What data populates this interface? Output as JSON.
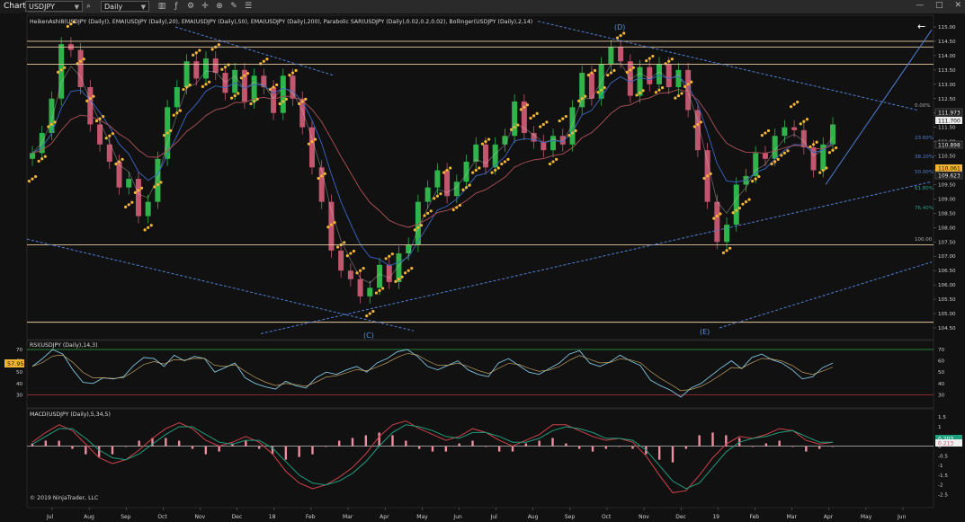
{
  "toolbar": {
    "tab_label": "Chart",
    "instrument": "USDJPY",
    "timeframe": "Daily",
    "window_buttons": [
      "—",
      "□",
      "✕"
    ]
  },
  "panels": {
    "price": {
      "indicator_header": "HeikenAshi8(USDJPY (Daily)), EMA(USDJPY (Daily),20), EMA(USDJPY (Daily),50), EMA(USDJPY (Daily),200), Parabolic SAR(USDJPY (Daily),0.02,0.2,0.02), Bollinger(USDJPY (Daily),2,14)",
      "wave_labels": [
        "(D)",
        "(C)",
        "(E)"
      ],
      "fib_labels": [
        "0.00%",
        "23.60%",
        "38.20%",
        "50.00%",
        "61.80%",
        "76.40%",
        "100.00"
      ],
      "price_badges": [
        "111.973",
        "111.700",
        "110.898",
        "110.061",
        "109.623"
      ],
      "arrow_glyph": "←"
    },
    "rsi": {
      "header": "RSI(USDJPY (Daily),14,3)",
      "current_value": "57.95"
    },
    "macd": {
      "header": "MACD(USDJPY (Daily),5,34,5)",
      "badge_1": "0.203",
      "badge_2": "0.213"
    }
  },
  "copyright": "© 2019 NinjaTrader, LLC",
  "colors": {
    "background": "#111111",
    "bull_candle": "#2fb34a",
    "bear_candle": "#c2566e",
    "sar_dots": "#f2b533",
    "trendline": "#4f7fd1",
    "horizontal_line": "#e8c9a0",
    "ema_200": "#b1525a",
    "ema_50": "#3b67c4",
    "rsi_line": "#7ec2dd",
    "macd_line": "#d0424a",
    "macd_signal": "#1f9d7d",
    "macd_histogram": "#f08ea1"
  },
  "chart_data": {
    "type": "candlestick",
    "instrument": "USDJPY",
    "timeframe": "Daily",
    "x_axis_ticks": [
      "Jul",
      "Aug",
      "Sep",
      "Oct",
      "Nov",
      "Dec",
      "18",
      "Feb",
      "Mar",
      "Apr",
      "May",
      "Jun",
      "Jul",
      "Aug",
      "Sep",
      "Oct",
      "Nov",
      "Dec",
      "19",
      "Feb",
      "Mar",
      "Apr",
      "May",
      "Jun"
    ],
    "price_axis": {
      "ticks": [
        104.5,
        105.0,
        105.5,
        106.0,
        106.5,
        107.0,
        107.5,
        108.0,
        108.5,
        109.0,
        109.5,
        110.0,
        110.5,
        111.0,
        111.5,
        112.0,
        112.5,
        113.0,
        113.5,
        114.0,
        114.5,
        115.0
      ],
      "range": [
        104.3,
        115.2
      ]
    },
    "price_series": {
      "name": "USDJPY",
      "closes": [
        110.6,
        111.3,
        112.5,
        114.4,
        114.2,
        112.9,
        111.6,
        110.9,
        110.3,
        109.4,
        109.7,
        108.4,
        108.9,
        110.4,
        112.2,
        112.9,
        113.8,
        113.2,
        113.9,
        113.4,
        112.7,
        113.5,
        112.4,
        113.3,
        112.9,
        112.0,
        113.3,
        112.5,
        111.5,
        110.1,
        108.9,
        107.2,
        106.5,
        106.2,
        105.6,
        105.9,
        106.7,
        106.1,
        107.1,
        107.4,
        108.9,
        109.4,
        110.0,
        109.1,
        109.6,
        110.3,
        110.9,
        110.1,
        110.9,
        111.2,
        112.4,
        111.3,
        111.0,
        110.7,
        111.2,
        110.9,
        112.2,
        113.4,
        112.5,
        113.7,
        114.3,
        113.8,
        112.6,
        113.6,
        113.0,
        113.7,
        112.9,
        113.5,
        112.1,
        110.7,
        108.9,
        107.5,
        108.1,
        109.5,
        109.8,
        110.6,
        110.4,
        111.2,
        111.5,
        111.4,
        110.8,
        110.0,
        110.9,
        111.6
      ]
    },
    "horizontal_levels": [
      114.5,
      114.3,
      113.7,
      107.4,
      104.7
    ],
    "rsi_axis": {
      "ticks": [
        30,
        40,
        50,
        60,
        70
      ],
      "range": [
        20,
        74
      ],
      "overbought": 70,
      "oversold": 30
    },
    "rsi_series": {
      "values": [
        55,
        62,
        70,
        66,
        52,
        41,
        40,
        45,
        44,
        46,
        56,
        63,
        62,
        55,
        65,
        60,
        64,
        62,
        50,
        54,
        58,
        45,
        40,
        37,
        35,
        42,
        38,
        36,
        45,
        50,
        48,
        52,
        55,
        50,
        58,
        62,
        68,
        70,
        64,
        55,
        52,
        56,
        60,
        52,
        48,
        46,
        58,
        62,
        56,
        50,
        48,
        53,
        58,
        66,
        69,
        58,
        55,
        59,
        65,
        60,
        56,
        43,
        38,
        34,
        28,
        36,
        40,
        47,
        54,
        60,
        53,
        63,
        66,
        61,
        58,
        52,
        44,
        46,
        54,
        58
      ]
    },
    "macd_axis": {
      "ticks": [
        -2.5,
        -2,
        -1.5,
        -1,
        -0.5,
        0,
        0.5,
        1,
        1.5
      ],
      "range": [
        -2.8,
        1.6
      ]
    },
    "macd_series": {
      "macd": [
        0.2,
        0.7,
        1.1,
        0.8,
        0.1,
        -0.6,
        -0.9,
        -0.7,
        -0.2,
        0.4,
        0.9,
        1.2,
        0.9,
        0.3,
        0.0,
        0.2,
        0.5,
        0.2,
        -0.4,
        -1.3,
        -1.9,
        -2.2,
        -2.0,
        -1.6,
        -1.1,
        -0.4,
        0.5,
        1.1,
        1.3,
        0.9,
        0.6,
        0.3,
        0.5,
        0.9,
        0.7,
        0.3,
        0.0,
        0.3,
        0.6,
        1.1,
        1.1,
        0.8,
        0.5,
        0.3,
        0.4,
        0.2,
        -0.5,
        -1.5,
        -2.4,
        -2.3,
        -1.5,
        -0.6,
        0.1,
        0.5,
        0.4,
        0.6,
        0.9,
        0.8,
        0.3,
        0.1,
        0.2
      ],
      "signal": [
        0.1,
        0.5,
        0.9,
        0.9,
        0.4,
        -0.2,
        -0.6,
        -0.7,
        -0.4,
        0.1,
        0.6,
        1.0,
        1.0,
        0.6,
        0.2,
        0.1,
        0.3,
        0.3,
        -0.1,
        -0.8,
        -1.5,
        -1.9,
        -2.0,
        -1.8,
        -1.4,
        -0.8,
        0.0,
        0.7,
        1.1,
        1.0,
        0.8,
        0.5,
        0.4,
        0.7,
        0.7,
        0.5,
        0.2,
        0.2,
        0.4,
        0.8,
        1.0,
        0.9,
        0.7,
        0.4,
        0.4,
        0.3,
        -0.2,
        -1.0,
        -1.8,
        -2.2,
        -1.9,
        -1.1,
        -0.3,
        0.2,
        0.4,
        0.5,
        0.7,
        0.8,
        0.5,
        0.2,
        0.2
      ]
    },
    "last_values": {
      "price": 111.7,
      "rsi": 57.95,
      "macd": 0.213,
      "macd_signal": 0.203
    }
  }
}
